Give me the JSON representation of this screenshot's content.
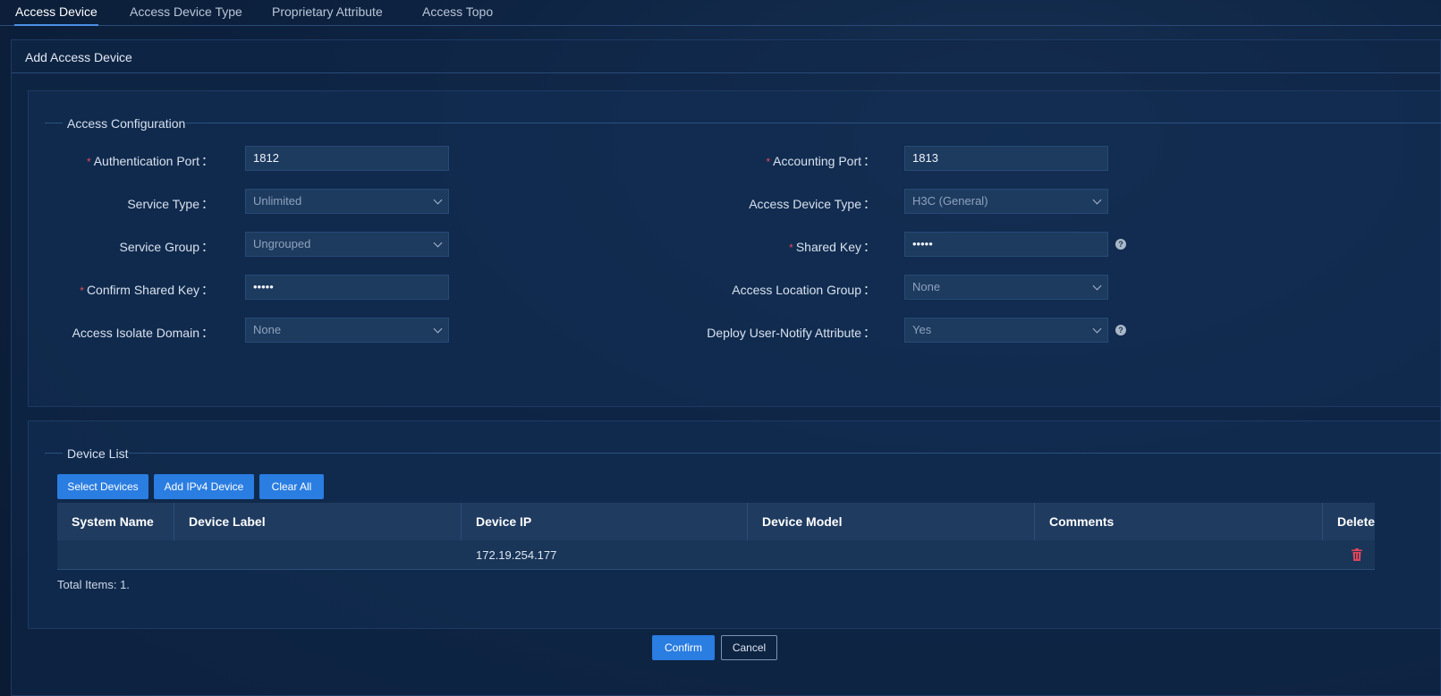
{
  "tabs": [
    {
      "label": "Access Device"
    },
    {
      "label": "Access Device Type"
    },
    {
      "label": "Proprietary Attribute"
    },
    {
      "label": "Access Topo"
    }
  ],
  "page": {
    "title": "Add Access Device"
  },
  "config": {
    "legend": "Access Configuration",
    "auth_port": {
      "label": "Authentication Port",
      "value": "1812"
    },
    "acct_port": {
      "label": "Accounting Port",
      "value": "1813"
    },
    "service_type": {
      "label": "Service Type",
      "value": "Unlimited"
    },
    "device_type": {
      "label": "Access Device Type",
      "value": "H3C (General)"
    },
    "service_group": {
      "label": "Service Group",
      "value": "Ungrouped"
    },
    "shared_key": {
      "label": "Shared Key",
      "value": "•••••"
    },
    "confirm_key": {
      "label": "Confirm Shared Key",
      "value": "•••••"
    },
    "location_group": {
      "label": "Access Location Group",
      "value": "None"
    },
    "isolate_domain": {
      "label": "Access Isolate Domain",
      "value": "None"
    },
    "deploy_notify": {
      "label": "Deploy User-Notify Attribute",
      "value": "Yes"
    },
    "colon": "：",
    "required_mark": "*",
    "help_glyph": "?"
  },
  "devices": {
    "legend": "Device List",
    "buttons": {
      "select": "Select Devices",
      "add_ipv4": "Add IPv4 Device",
      "clear": "Clear All"
    },
    "columns": [
      "System Name",
      "Device Label",
      "Device IP",
      "Device Model",
      "Comments",
      "Delete"
    ],
    "rows": [
      {
        "system_name": "",
        "device_label": "",
        "device_ip": "172.19.254.177",
        "device_model": "",
        "comments": ""
      }
    ],
    "total": "Total Items: 1."
  },
  "footer": {
    "confirm": "Confirm",
    "cancel": "Cancel"
  },
  "colors": {
    "accent": "#2a7de1",
    "required": "#e04a5a",
    "delete": "#e0455a"
  }
}
